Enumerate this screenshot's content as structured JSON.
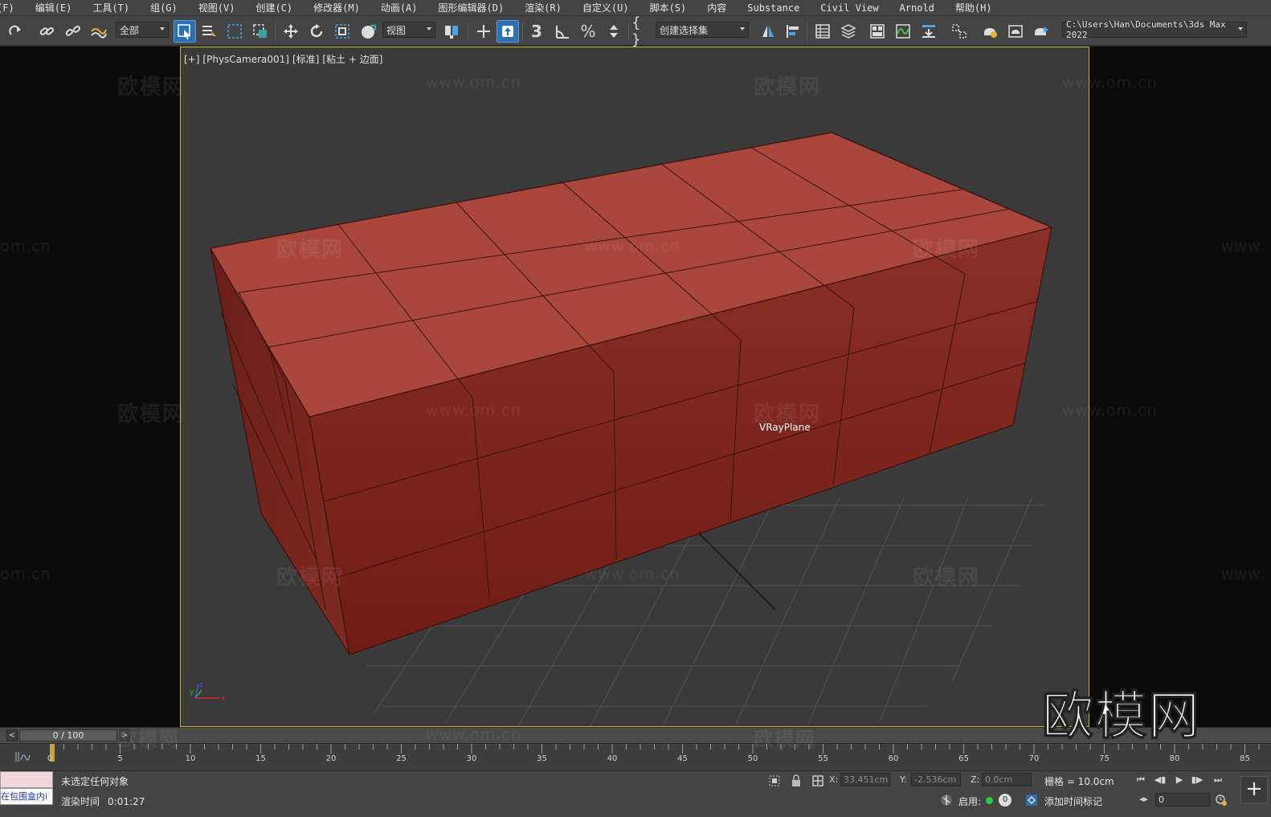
{
  "menubar": {
    "items": [
      "(F)",
      "编辑(E)",
      "工具(T)",
      "组(G)",
      "视图(V)",
      "创建(C)",
      "修改器(M)",
      "动画(A)",
      "图形编辑器(D)",
      "渲染(R)",
      "自定义(U)",
      "脚本(S)",
      "内容",
      "Substance",
      "Civil View",
      "Arnold",
      "帮助(H)"
    ]
  },
  "toolbar": {
    "selection_filter": "全部",
    "reference_coord": "视图",
    "named_selection": "创建选择集",
    "project_path": "C:\\Users\\Han\\Documents\\3ds Max 2022",
    "snap_label": "3"
  },
  "viewport": {
    "label_parts": [
      "[+]",
      "[PhysCamera001]",
      "[标准]",
      "[粘土 + 边面]"
    ],
    "object_label": "VRayPlane",
    "object_color": "#a8463c",
    "border_color": "#c8b23a",
    "gizmo_axes": [
      "x",
      "y",
      "z"
    ]
  },
  "watermarks": {
    "brand": "欧模网",
    "url": "www.om.cn",
    "url_partial": "om.cn",
    "url_partial_right": "www.",
    "logo": "欧模网"
  },
  "timeslider": {
    "frame_display": "0 / 100",
    "prev": "<",
    "next": ">"
  },
  "trackbar": {
    "ticks": [
      "0",
      "5",
      "10",
      "15",
      "20",
      "25",
      "30",
      "35",
      "40",
      "45",
      "50",
      "55",
      "60",
      "65",
      "70",
      "75",
      "80",
      "85"
    ]
  },
  "status": {
    "listener_text": "在包围盒内i",
    "message": "未选定任何对象",
    "render_time_label": "渲染时间",
    "render_time_value": "0:01:27",
    "x_label": "X:",
    "x_value": "33.451cm",
    "y_label": "Y:",
    "y_value": "-2.536cm",
    "z_label": "Z:",
    "z_value": "0.0cm",
    "grid": "栅格 = 10.0cm",
    "enable_label": "启用:",
    "key_count": "0",
    "add_time_tag": "添加时间标记",
    "current_frame": "0"
  }
}
